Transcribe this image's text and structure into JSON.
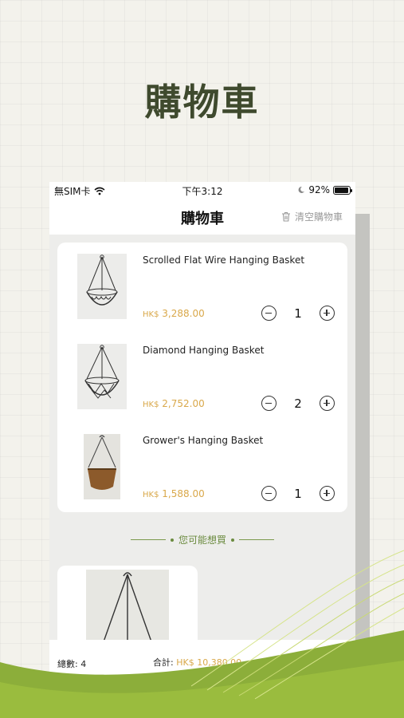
{
  "hero": {
    "title": "購物車"
  },
  "status_bar": {
    "carrier": "無SIM卡",
    "time": "下午3:12",
    "battery": "92%",
    "battery_level": 0.92
  },
  "navbar": {
    "title": "購物車",
    "clear_label": "清空購物車"
  },
  "cart": {
    "items": [
      {
        "name": "Scrolled Flat Wire Hanging Basket",
        "currency": "HK$",
        "price": "3,288.00",
        "qty": "1"
      },
      {
        "name": "Diamond Hanging Basket",
        "currency": "HK$",
        "price": "2,752.00",
        "qty": "2"
      },
      {
        "name": "Grower's Hanging Basket",
        "currency": "HK$",
        "price": "1,588.00",
        "qty": "1"
      }
    ]
  },
  "suggest": {
    "heading": "您可能想買"
  },
  "footer": {
    "count_label": "總數: 4",
    "sum_label": "合計:",
    "sum_value": "HK$ 10,380.00"
  },
  "colors": {
    "accent_green": "#6b8b3f",
    "price_gold": "#d9a84a",
    "title_dark_green": "#3f4a2e",
    "background": "#f3f2ec"
  },
  "icons": [
    "signal-icon",
    "wifi-icon",
    "moon-icon",
    "battery-icon",
    "trash-icon",
    "minus-icon",
    "plus-icon"
  ]
}
